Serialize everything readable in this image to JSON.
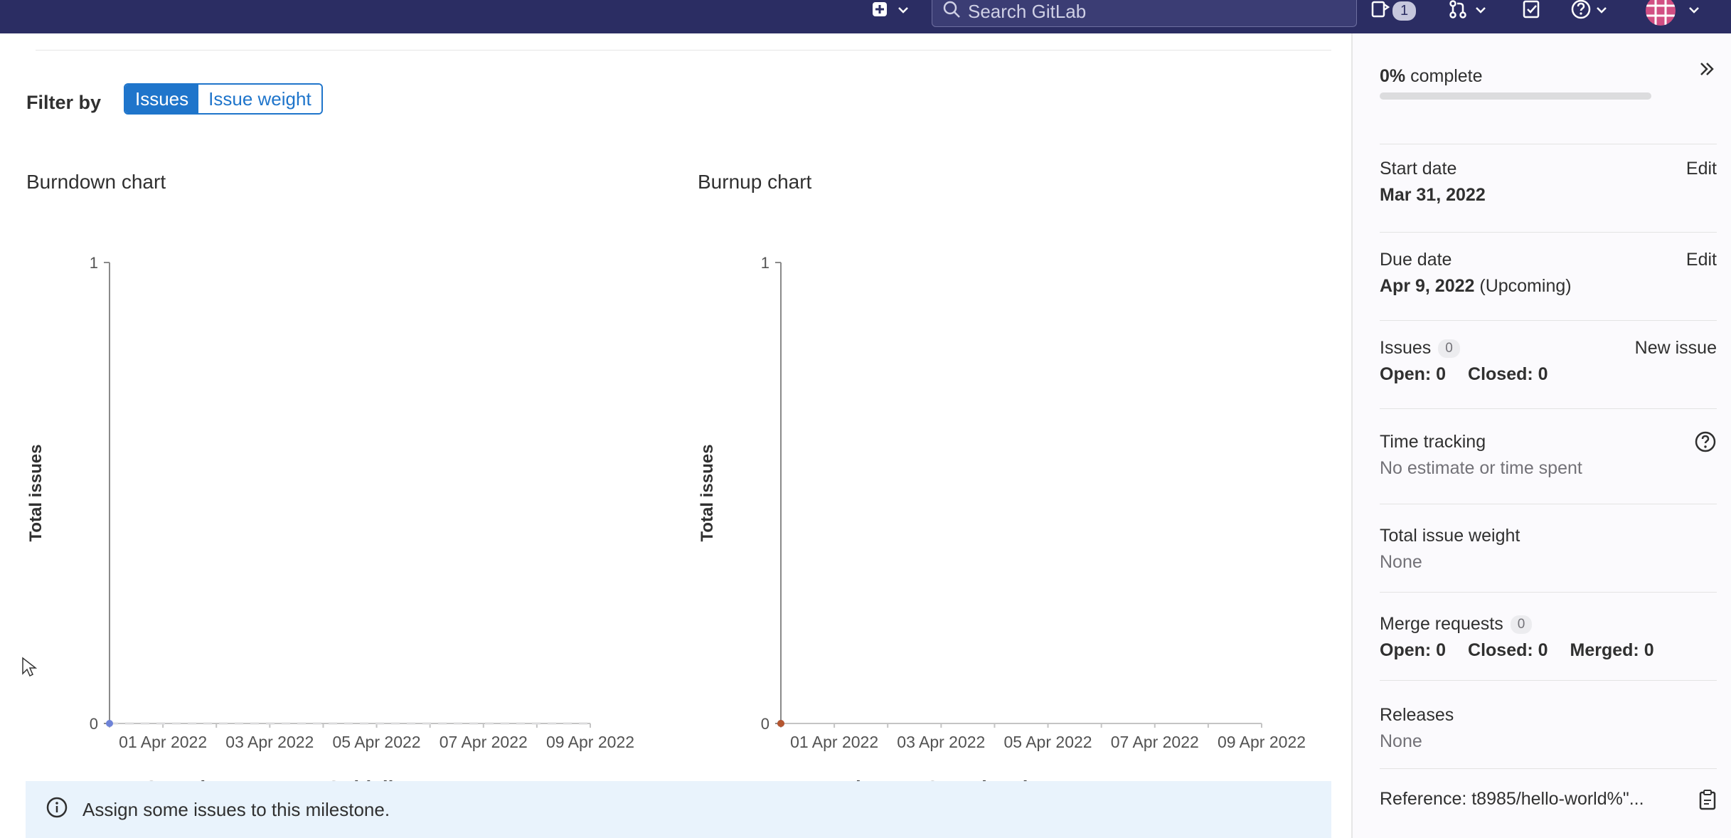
{
  "topbar": {
    "search_placeholder": "Search GitLab",
    "issues_badge": "1",
    "icons": [
      "plus-square-icon",
      "chevron-down-icon",
      "search-icon",
      "issues-icon",
      "merge-request-icon",
      "todo-icon",
      "help-icon",
      "avatar"
    ]
  },
  "filter": {
    "label": "Filter by",
    "options": [
      "Issues",
      "Issue weight"
    ],
    "selected": "Issues"
  },
  "burndown": {
    "title": "Burndown chart",
    "legend": [
      "Open issues",
      "Guideline"
    ]
  },
  "burnup": {
    "title": "Burnup chart",
    "legend": [
      "Total",
      "Completed"
    ]
  },
  "chart_data": [
    {
      "type": "line",
      "title": "Burndown chart",
      "xlabel": "",
      "ylabel": "Total issues",
      "y_ticks": [
        "0",
        "1"
      ],
      "ylim": [
        0,
        1
      ],
      "x_tick_labels": [
        "01 Apr 2022",
        "03 Apr 2022",
        "05 Apr 2022",
        "07 Apr 2022",
        "09 Apr 2022"
      ],
      "x": [
        "2022-03-31",
        "2022-04-01",
        "2022-04-02",
        "2022-04-03",
        "2022-04-04",
        "2022-04-05",
        "2022-04-06",
        "2022-04-07",
        "2022-04-08",
        "2022-04-09"
      ],
      "series": [
        {
          "name": "Open issues",
          "color": "#6e83d8",
          "values": [
            0
          ]
        },
        {
          "name": "Guideline",
          "color": "#dcdcde",
          "dashed": true,
          "values": [
            0,
            0,
            0,
            0,
            0,
            0,
            0,
            0,
            0,
            0
          ]
        }
      ]
    },
    {
      "type": "line",
      "title": "Burnup chart",
      "xlabel": "",
      "ylabel": "Total issues",
      "y_ticks": [
        "0",
        "1"
      ],
      "ylim": [
        0,
        1
      ],
      "x_tick_labels": [
        "01 Apr 2022",
        "03 Apr 2022",
        "05 Apr 2022",
        "07 Apr 2022",
        "09 Apr 2022"
      ],
      "x": [
        "2022-03-31",
        "2022-04-01",
        "2022-04-02",
        "2022-04-03",
        "2022-04-04",
        "2022-04-05",
        "2022-04-06",
        "2022-04-07",
        "2022-04-08",
        "2022-04-09"
      ],
      "series": [
        {
          "name": "Total",
          "color": "#6e83d8",
          "values": [
            0
          ]
        },
        {
          "name": "Completed",
          "color": "#b5562f",
          "values": [
            0
          ]
        }
      ]
    }
  ],
  "alert": {
    "text": "Assign some issues to this milestone."
  },
  "sidebar": {
    "progress_value": "0%",
    "progress_suffix": "complete",
    "progress_fraction": 0,
    "start_date": {
      "label": "Start date",
      "value": "Mar 31, 2022",
      "action": "Edit"
    },
    "due_date": {
      "label": "Due date",
      "value": "Apr 9, 2022",
      "note": "(Upcoming)",
      "action": "Edit"
    },
    "issues": {
      "label": "Issues",
      "count": "0",
      "open": "Open: 0",
      "closed": "Closed: 0",
      "action": "New issue"
    },
    "time_tracking": {
      "label": "Time tracking",
      "value": "No estimate or time spent"
    },
    "weight": {
      "label": "Total issue weight",
      "value": "None"
    },
    "merge_requests": {
      "label": "Merge requests",
      "count": "0",
      "open": "Open: 0",
      "closed": "Closed: 0",
      "merged": "Merged: 0"
    },
    "releases": {
      "label": "Releases",
      "value": "None"
    },
    "reference": {
      "text": "Reference: t8985/hello-world%\"..."
    }
  }
}
